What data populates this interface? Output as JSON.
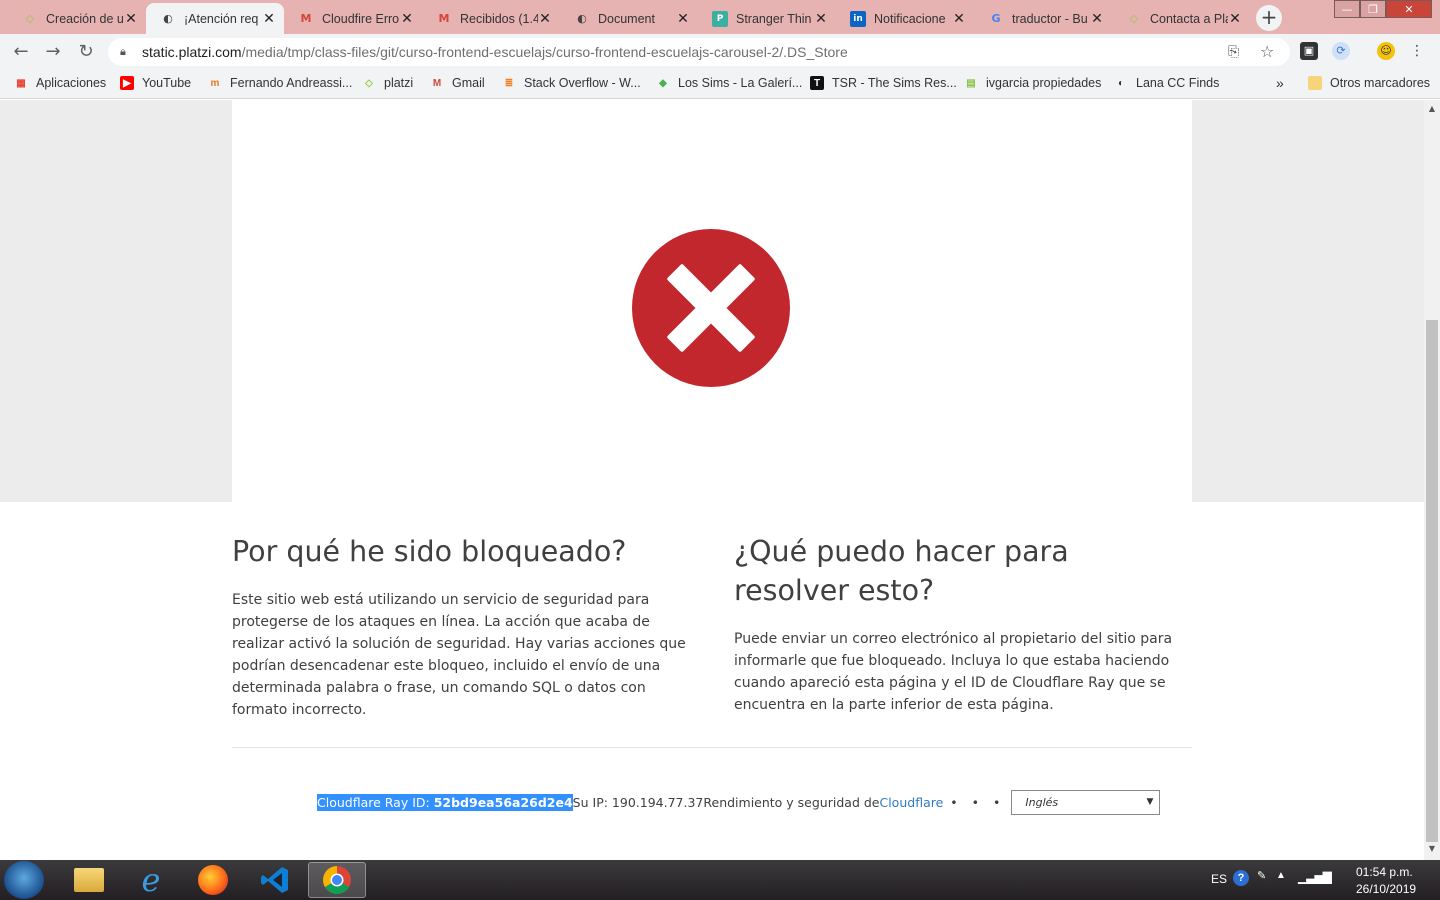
{
  "browser": {
    "tabs": [
      {
        "title": "Creación de u",
        "icon": "platzi-icon",
        "color": "#98ca3f",
        "active": false
      },
      {
        "title": "¡Atención req",
        "icon": "globe-icon",
        "color": "#444444",
        "active": true
      },
      {
        "title": "Cloudfire Erro",
        "icon": "gmail-icon",
        "color": "#d44638",
        "active": false
      },
      {
        "title": "Recibidos (1.4",
        "icon": "gmail-icon",
        "color": "#d44638",
        "active": false
      },
      {
        "title": "Document",
        "icon": "globe-icon",
        "color": "#444444",
        "active": false
      },
      {
        "title": "Stranger Thin",
        "icon": "p-icon",
        "color": "#3cb0a0",
        "active": false
      },
      {
        "title": "Notificacione",
        "icon": "linkedin-icon",
        "color": "#0a66c2",
        "active": false
      },
      {
        "title": "traductor - Bu",
        "icon": "google-icon",
        "color": "#4285f4",
        "active": false
      },
      {
        "title": "Contacta a Pla",
        "icon": "platzi-icon",
        "color": "#98ca3f",
        "active": false
      }
    ],
    "url_host": "static.platzi.com",
    "url_path": "/media/tmp/class-files/git/curso-frontend-escuelajs/curso-frontend-escuelajs-carousel-2/.DS_Store",
    "bookmarks": [
      {
        "label": "Aplicaciones",
        "icon": "apps-icon"
      },
      {
        "label": "YouTube",
        "icon": "youtube-icon"
      },
      {
        "label": "Fernando Andreassi...",
        "icon": "fernando-icon"
      },
      {
        "label": "platzi",
        "icon": "platzi-icon"
      },
      {
        "label": "Gmail",
        "icon": "gmail-icon"
      },
      {
        "label": "Stack Overflow - W...",
        "icon": "stackoverflow-icon"
      },
      {
        "label": "Los Sims - La Galerí...",
        "icon": "plumbob-icon"
      },
      {
        "label": "TSR - The Sims Res...",
        "icon": "tsr-icon"
      },
      {
        "label": "ivgarcia propiedades",
        "icon": "sheet-icon"
      },
      {
        "label": "Lana CC Finds",
        "icon": "globe-icon"
      }
    ],
    "bookmarks_overflow": "»",
    "other_bookmarks": "Otros marcadores"
  },
  "page": {
    "left_heading": "Por qué he sido bloqueado?",
    "left_body": "Este sitio web está utilizando un servicio de seguridad para protegerse de los ataques en línea. La acción que acaba de realizar activó la solución de seguridad. Hay varias acciones que podrían desencadenar este bloqueo, incluido el envío de una determinada palabra o frase, un comando SQL o datos con formato incorrecto.",
    "right_heading": "¿Qué puedo hacer para resolver esto?",
    "right_body": "Puede enviar un correo electrónico al propietario del sitio para informarle que fue bloqueado. Incluya lo que estaba haciendo cuando apareció esta página y el ID de Cloudflare Ray que se encuentra en la parte inferior de esta página.",
    "footer": {
      "ray_label": "Cloudflare Ray ID: ",
      "ray_id": "52bd9ea56a26d2e4",
      "ip_text": " Su IP: 190.194.77.37",
      "perf_text": "Rendimiento y seguridad de",
      "cloudflare_link": "Cloudflare",
      "dot": "•",
      "language": "Inglés"
    }
  },
  "taskbar": {
    "lang": "ES",
    "time": "01:54 p.m.",
    "date": "26/10/2019"
  },
  "colors": {
    "error_red": "#c1272d",
    "link_blue": "#2f7bbf",
    "selection": "#3390ff",
    "tabstrip": "#e6b2b2"
  }
}
